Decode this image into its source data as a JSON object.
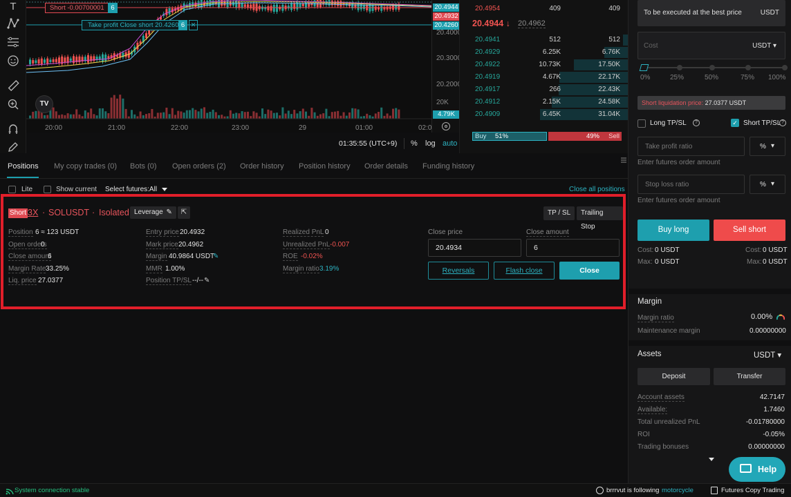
{
  "chart": {
    "short_order_label": "Short -0.00700001",
    "short_order_count": "6",
    "tp_label": "Take profit Close short 20.4260",
    "tp_count": "6",
    "tp_close": "✕",
    "price_ticks": [
      "20.4000",
      "20.3000",
      "20.2000",
      "20K"
    ],
    "price_tags": {
      "ask": "20.4944",
      "mark": "20.4932",
      "tp": "20.4260",
      "vol": "4.79K"
    },
    "time_ticks": [
      "20:00",
      "21:00",
      "22:00",
      "23:00",
      "29",
      "01:00",
      "02:0"
    ],
    "clock": "01:35:55 (UTC+9)",
    "pct": "%",
    "log": "log",
    "auto": "auto",
    "tv_logo": "TV"
  },
  "book": {
    "top_ask": {
      "price": "20.4954",
      "qty": "409",
      "total": "409"
    },
    "last": {
      "price": "20.4944",
      "arrow": "↓",
      "mark": "20.4962"
    },
    "bids": [
      {
        "price": "20.4941",
        "qty": "512",
        "total": "512",
        "depth": 0.06
      },
      {
        "price": "20.4929",
        "qty": "6.25K",
        "total": "6.76K",
        "depth": 0.27
      },
      {
        "price": "20.4922",
        "qty": "10.73K",
        "total": "17.50K",
        "depth": 0.62
      },
      {
        "price": "20.4919",
        "qty": "4.67K",
        "total": "22.17K",
        "depth": 0.78
      },
      {
        "price": "20.4917",
        "qty": "266",
        "total": "22.43K",
        "depth": 0.79
      },
      {
        "price": "20.4912",
        "qty": "2.15K",
        "total": "24.58K",
        "depth": 0.87
      },
      {
        "price": "20.4909",
        "qty": "6.45K",
        "total": "31.04K",
        "depth": 1.0
      }
    ],
    "buy_label": "Buy",
    "buy_pct": "51%",
    "sell_pct": "49%",
    "sell_label": "Sell",
    "buy_ratio": 0.51
  },
  "tabs": [
    "Positions",
    "My copy trades (0)",
    "Bots (0)",
    "Open orders (2)",
    "Order history",
    "Position history",
    "Order details",
    "Funding history"
  ],
  "filters": {
    "lite": "Lite",
    "show_current": "Show current",
    "select_futures": "Select futures:All",
    "close_all": "Close all positions"
  },
  "position": {
    "side": "Short",
    "leverage": "3X",
    "dot": "·",
    "symbol": "SOLUSDT",
    "mode": "Isolated",
    "leverage_btn": "Leverage",
    "tp_sl_btn": "TP / SL",
    "trailing_btn": "Trailing Stop",
    "col1": [
      {
        "label": "Position",
        "value": "6 ≈ 123 USDT"
      },
      {
        "label": "Open orders",
        "value": "0"
      },
      {
        "label": "Close amount",
        "value": "6"
      },
      {
        "label": "Margin Rate",
        "value": "33.25%"
      },
      {
        "label": "Liq. price",
        "value": "27.0377"
      }
    ],
    "col2": [
      {
        "label": "Entry price",
        "value": "20.4932"
      },
      {
        "label": "Mark price",
        "value": "20.4962"
      },
      {
        "label": "Margin",
        "value": "40.9864 USDT"
      },
      {
        "label": "MMR",
        "value": "1.00%"
      },
      {
        "label": "Position TP/SL",
        "value": "--/--"
      }
    ],
    "col3": [
      {
        "label": "Realized PnL",
        "value": "0"
      },
      {
        "label": "Unrealized PnL",
        "value": "-0.007"
      },
      {
        "label": "ROE",
        "value": "-0.02%"
      },
      {
        "label": "Margin ratio",
        "value": "3.19%"
      }
    ],
    "close_price_label": "Close price",
    "close_price": "20.4934",
    "close_amount_label": "Close amount",
    "close_amount": "6",
    "reversals": "Reversals",
    "flash_close": "Flash close",
    "close": "Close"
  },
  "panel": {
    "best_price": "To be executed at the best price",
    "best_price_unit": "USDT",
    "cost_placeholder": "Cost",
    "cost_unit": "USDT",
    "slider_marks": [
      "0%",
      "25%",
      "50%",
      "75%",
      "100%"
    ],
    "liq_label": "Short liquidation price:",
    "liq_value": "27.0377 USDT",
    "long_tpsl": "Long TP/SL",
    "short_tpsl": "Short TP/SL",
    "tp_placeholder": "Take profit ratio",
    "tp_unit": "%",
    "tp_hint": "Enter futures order amount",
    "sl_placeholder": "Stop loss ratio",
    "sl_unit": "%",
    "sl_hint": "Enter futures order amount",
    "buy_long": "Buy long",
    "sell_short": "Sell short",
    "cost_left_label": "Cost:",
    "cost_left": "0 USDT",
    "cost_right_label": "Cost:",
    "cost_right": "0 USDT",
    "max_left_label": "Max:",
    "max_left": "0 USDT",
    "max_right_label": "Max:",
    "max_right": "0 USDT",
    "margin_title": "Margin",
    "margin_ratio_label": "Margin ratio",
    "margin_ratio": "0.00%",
    "maint_label": "Maintenance margin",
    "maint_value": "0.00000000",
    "assets_title": "Assets",
    "assets_unit": "USDT",
    "deposit": "Deposit",
    "transfer": "Transfer",
    "rows": [
      {
        "label": "Account assets",
        "value": "42.7147"
      },
      {
        "label": "Available:",
        "value": "1.7460"
      },
      {
        "label": "Total unrealized PnL",
        "value": "-0.01780000"
      },
      {
        "label": "ROI",
        "value": "-0.05%"
      },
      {
        "label": "Trading bonuses",
        "value": "0.00000000"
      }
    ],
    "help": "Help"
  },
  "status": {
    "connection": "System connection stable",
    "user": "brrrvut",
    "following": "is following",
    "leader": "motorcycle",
    "copy": "Futures Copy Trading"
  },
  "colors": {
    "green": "#26a69a",
    "red": "#ef5350",
    "accent": "#1c9fae"
  }
}
